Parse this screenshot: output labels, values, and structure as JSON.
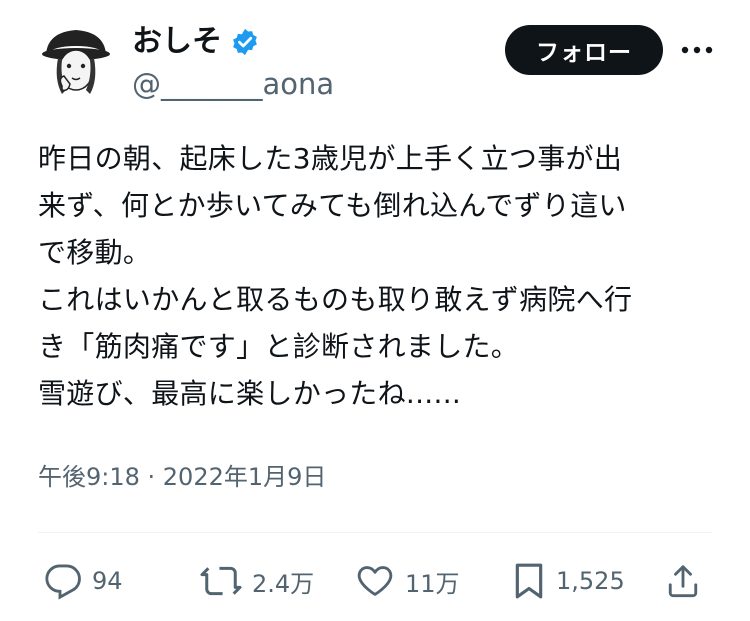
{
  "author": {
    "display_name": "おしそ",
    "handle": "@_______aona",
    "verified_icon": "verified-badge-icon",
    "avatar": "illustrated-avatar"
  },
  "header": {
    "follow_label": "フォロー",
    "more_icon": "more-dots-icon"
  },
  "tweet": {
    "lines": [
      "昨日の朝、起床した3歳児が上手く立つ事が出",
      "来ず、何とか歩いてみても倒れ込んでずり這い",
      "で移動。",
      "これはいかんと取るものも取り敢えず病院へ行",
      "き「筋肉痛です」と診断されました。",
      "雪遊び、最高に楽しかったね......"
    ],
    "timestamp": "午後9:18 · 2022年1月9日"
  },
  "actions": {
    "reply_count": "94",
    "retweet_count": "2.4万",
    "like_count": "11万",
    "bookmark_count": "1,525"
  },
  "colors": {
    "text": "#0f1419",
    "secondary": "#536471",
    "verified_blue": "#1d9bf0",
    "follow_bg": "#0f1419"
  }
}
